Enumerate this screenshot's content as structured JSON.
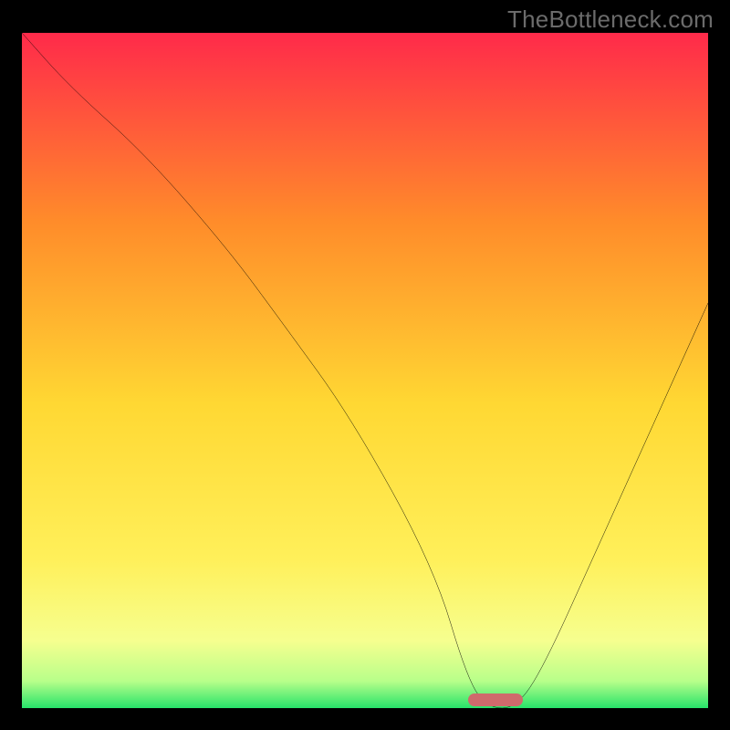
{
  "watermark": {
    "text": "TheBottleneck.com"
  },
  "plot": {
    "colors": {
      "top": "#ff2a4a",
      "mid_upper": "#ff8c2a",
      "mid": "#ffd833",
      "mid_lower": "#fff05a",
      "near_bottom": "#f6ff8f",
      "pale_green": "#b8ff8a",
      "green": "#27e36a",
      "curve_stroke": "#000000",
      "marker_fill": "#cf6a6c"
    }
  },
  "chart_data": {
    "type": "line",
    "title": "",
    "xlabel": "",
    "ylabel": "",
    "xlim": [
      0,
      100
    ],
    "ylim": [
      0,
      100
    ],
    "series": [
      {
        "name": "curve",
        "x": [
          0,
          7,
          18,
          30,
          38,
          48,
          60,
          65,
          68,
          72,
          76,
          84,
          92,
          100
        ],
        "values": [
          100,
          92,
          82,
          68,
          57,
          43,
          21,
          4,
          0,
          0,
          6,
          24,
          42,
          60
        ]
      }
    ],
    "marker": {
      "x_start": 65,
      "x_end": 73,
      "y": 0
    },
    "legend": []
  }
}
